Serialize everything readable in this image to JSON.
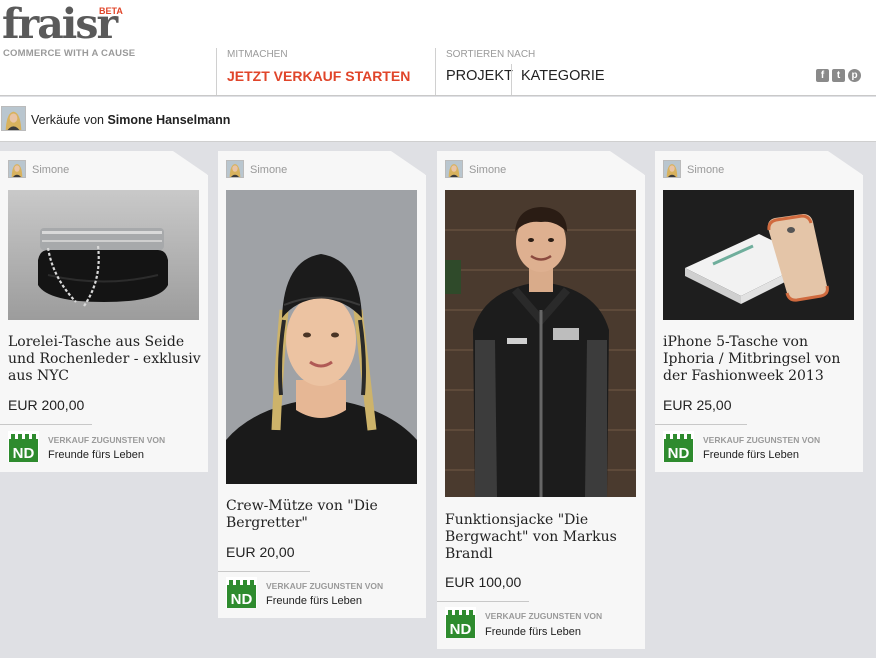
{
  "logo": {
    "word": "fraisr",
    "badge": "BETA",
    "tagline": "COMMERCE WITH A CAUSE"
  },
  "nav": {
    "mitmachen_label": "MITMACHEN",
    "cta": "JETZT VERKAUF STARTEN",
    "sort_label": "SORTIEREN NACH",
    "sort_project": "PROJEKT",
    "sort_category": "KATEGORIE"
  },
  "social": [
    "facebook-icon",
    "twitter-icon",
    "pinterest-icon"
  ],
  "seller": {
    "prefix": "Verkäufe von",
    "name": "Simone Hanselmann"
  },
  "charity_label": "VERKAUF ZUGUNSTEN VON",
  "products": [
    {
      "user": "Simone",
      "title": "Lorelei-Tasche aus Seide und Rochenleder - exklusiv aus NYC",
      "price": "EUR 200,00",
      "charity": "Freunde fürs Leben"
    },
    {
      "user": "Simone",
      "title": "Crew-Mütze von \"Die Bergretter\"",
      "price": "EUR 20,00",
      "charity": "Freunde fürs Leben"
    },
    {
      "user": "Simone",
      "title": "Funktionsjacke \"Die Bergwacht\" von Markus Brandl",
      "price": "EUR 100,00",
      "charity": "Freunde fürs Leben"
    },
    {
      "user": "Simone",
      "title": "iPhone 5-Tasche von Iphoria / Mitbringsel von der Fashionweek 2013",
      "price": "EUR 25,00",
      "charity": "Freunde fürs Leben"
    }
  ],
  "colors": {
    "accent": "#e0452a",
    "charity_green": "#2e8b2e",
    "background": "#dfe0e4"
  }
}
